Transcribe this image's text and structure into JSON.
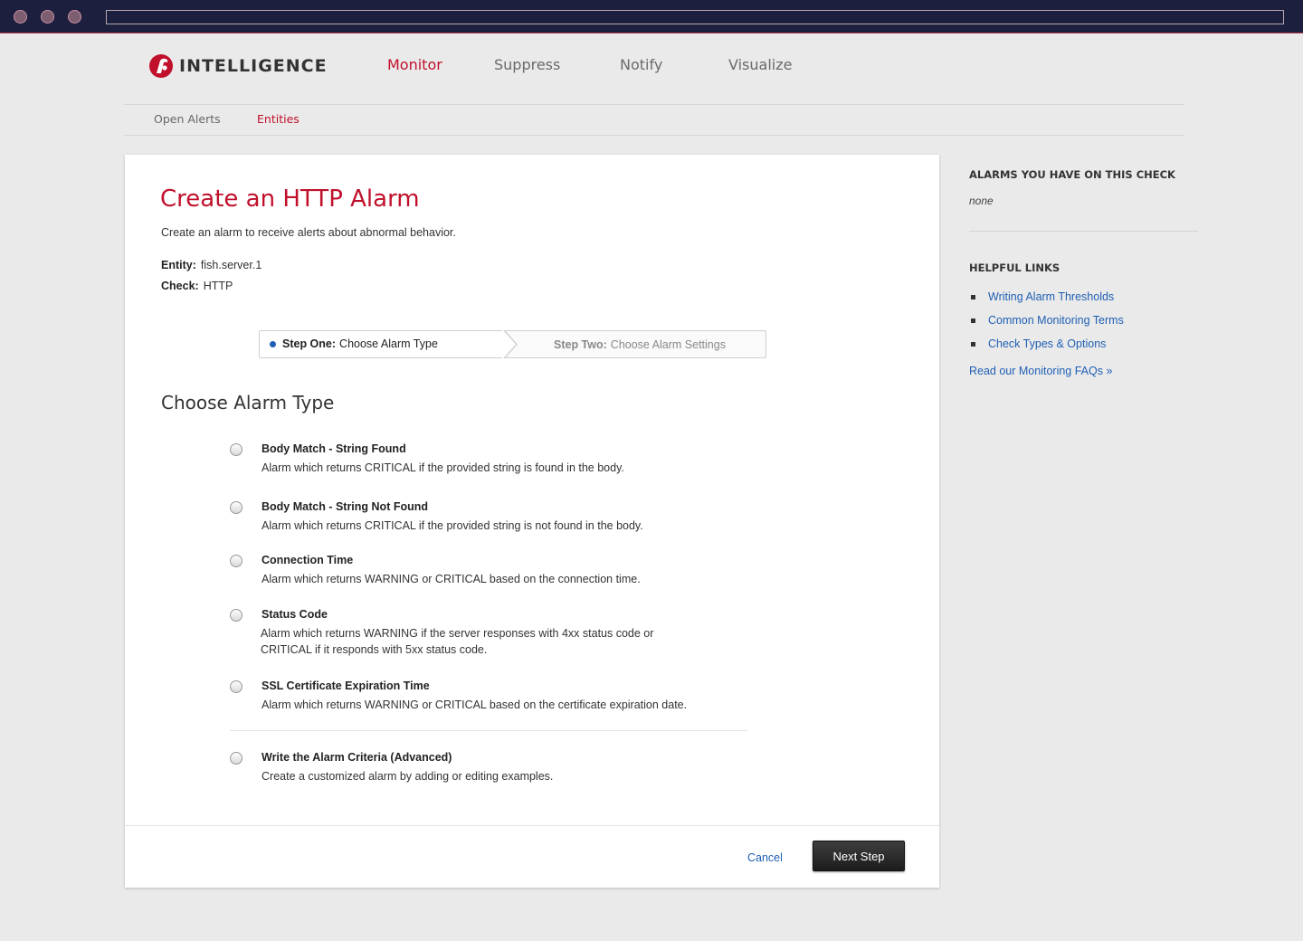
{
  "brand": {
    "name": "INTELLIGENCE",
    "logo_icon": "rackspace-logo-icon",
    "accent_color": "#c0102c",
    "link_color": "#1f5fb4"
  },
  "main_nav": [
    {
      "label": "Monitor",
      "active": true
    },
    {
      "label": "Suppress",
      "active": false
    },
    {
      "label": "Notify",
      "active": false
    },
    {
      "label": "Visualize",
      "active": false
    }
  ],
  "sub_nav": [
    {
      "label": "Open Alerts",
      "active": false
    },
    {
      "label": "Entities",
      "active": true
    }
  ],
  "page": {
    "title": "Create an HTTP Alarm",
    "description": "Create an alarm to receive alerts about abnormal behavior.",
    "entity_label": "Entity:",
    "entity_value": "fish.server.1",
    "check_label": "Check:",
    "check_value": "HTTP"
  },
  "steps": [
    {
      "label": "Step One:",
      "text": "Choose Alarm Type",
      "active": true
    },
    {
      "label": "Step Two:",
      "text": "Choose Alarm Settings",
      "active": false
    }
  ],
  "alarm_section": {
    "title": "Choose Alarm Type",
    "options": [
      {
        "title": "Body Match - String Found",
        "description": "Alarm which returns CRITICAL if the provided string is found in the body.",
        "selected": false
      },
      {
        "title": "Body Match - String Not Found",
        "description": "Alarm which returns CRITICAL if the provided string is not found in the body.",
        "selected": false
      },
      {
        "title": "Connection Time",
        "description": "Alarm which returns WARNING or CRITICAL based on the connection time.",
        "selected": false
      },
      {
        "title": "Status Code",
        "description": "Alarm which returns WARNING if the server responses with 4xx status code or CRITICAL if it responds with 5xx status code.",
        "selected": false
      },
      {
        "title": "SSL Certificate Expiration Time",
        "description": "Alarm which returns WARNING or CRITICAL based on the certificate expiration date.",
        "selected": false
      },
      {
        "title": "Write the Alarm Criteria (Advanced)",
        "description": "Create a customized alarm by adding or editing examples.",
        "selected": false
      }
    ]
  },
  "actions": {
    "cancel": "Cancel",
    "next": "Next Step"
  },
  "sidebar": {
    "alarms_heading": "ALARMS YOU HAVE ON THIS CHECK",
    "alarms_value": "none",
    "links_heading": "HELPFUL LINKS",
    "links": [
      {
        "label": "Writing Alarm Thresholds"
      },
      {
        "label": "Common Monitoring Terms"
      },
      {
        "label": "Check Types & Options"
      }
    ],
    "faq_link": "Read our Monitoring FAQs »"
  }
}
